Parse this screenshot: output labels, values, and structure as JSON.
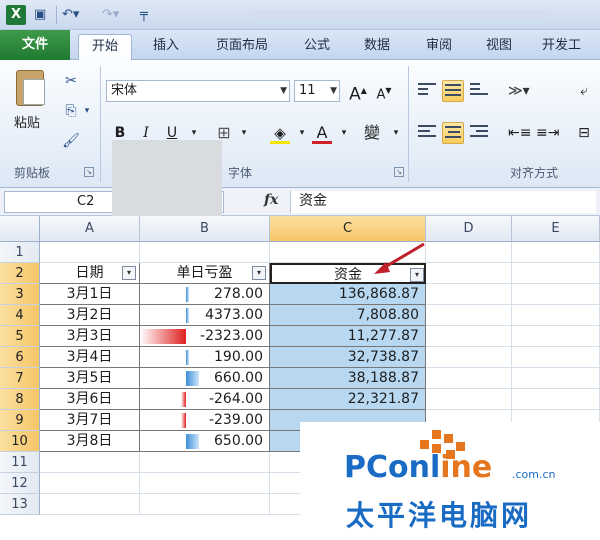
{
  "window": {
    "app_icon": "excel-icon",
    "qat_icons": [
      "save-icon",
      "undo-icon",
      "redo-icon",
      "customize-qat-icon"
    ],
    "title_blurred": true
  },
  "tabs": [
    {
      "label": "文件"
    },
    {
      "label": "开始"
    },
    {
      "label": "插入"
    },
    {
      "label": "页面布局"
    },
    {
      "label": "公式"
    },
    {
      "label": "数据"
    },
    {
      "label": "审阅"
    },
    {
      "label": "视图"
    },
    {
      "label": "开发工"
    }
  ],
  "ribbon": {
    "clipboard": {
      "paste_label": "粘贴",
      "group_label": "剪贴板"
    },
    "font": {
      "font_name": "宋体",
      "font_size": "11",
      "bold": "B",
      "italic": "I",
      "underline": "U",
      "font_color": "A",
      "wen": "變",
      "group_label": "字体"
    },
    "alignment": {
      "group_label": "对齐方式"
    }
  },
  "formula_bar": {
    "cell_ref": "C2",
    "fx": "fx",
    "content": "资金"
  },
  "columns": [
    "A",
    "B",
    "C",
    "D",
    "E"
  ],
  "rows": [
    "1",
    "2",
    "3",
    "4",
    "5",
    "6",
    "7",
    "8",
    "9",
    "10",
    "11",
    "12",
    "13"
  ],
  "table": {
    "headers": [
      "日期",
      "单日亏盈",
      "资金"
    ],
    "rows": [
      {
        "date": "3月1日",
        "daily": "278.00",
        "fund": "136,868.87",
        "bar": 0.02,
        "neg": false
      },
      {
        "date": "3月2日",
        "daily": "4373.00",
        "fund": "7,808.80",
        "bar": 0.02,
        "neg": false
      },
      {
        "date": "3月3日",
        "daily": "-2323.00",
        "fund": "11,277.87",
        "bar": 0.35,
        "neg": true
      },
      {
        "date": "3月4日",
        "daily": "190.00",
        "fund": "32,738.87",
        "bar": 0.02,
        "neg": false
      },
      {
        "date": "3月5日",
        "daily": "660.00",
        "fund": "38,188.87",
        "bar": 0.1,
        "neg": false
      },
      {
        "date": "3月6日",
        "daily": "-264.00",
        "fund": "22,321.87",
        "bar": 0.04,
        "neg": true
      },
      {
        "date": "3月7日",
        "daily": "-239.00",
        "fund": "",
        "bar": 0.04,
        "neg": true
      },
      {
        "date": "3月8日",
        "daily": "650.00",
        "fund": "",
        "bar": 0.1,
        "neg": false
      }
    ]
  },
  "colors": {
    "positive_bar": "#3c8fd6",
    "negative_bar": "#e02020",
    "selected_fill": "#b8d8f2",
    "accent_arrow": "#c0202a"
  },
  "watermark": {
    "brand": "PConline",
    "domain": ".com.cn",
    "cn": "太平洋电脑网"
  }
}
